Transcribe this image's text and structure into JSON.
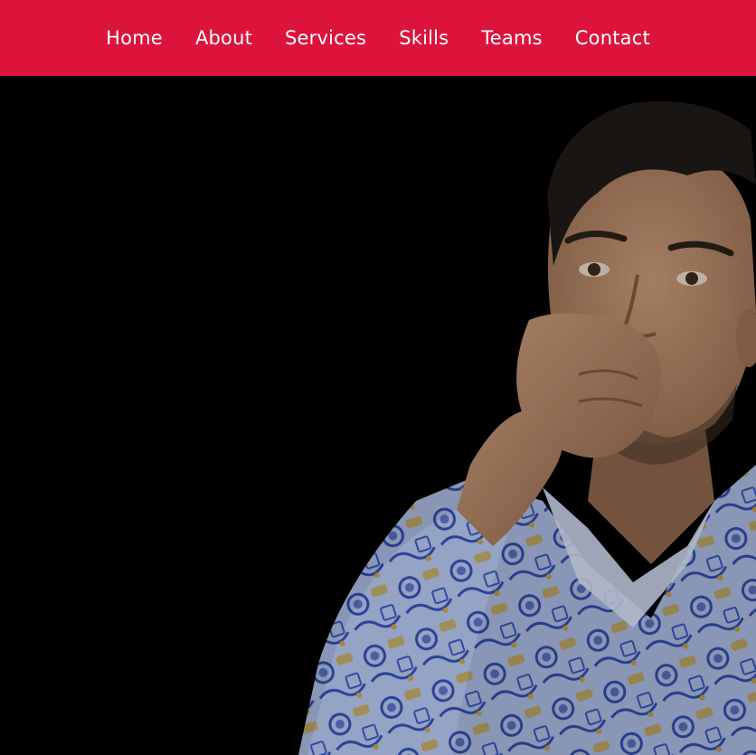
{
  "colors": {
    "nav_bg": "#dc143c",
    "nav_text": "#ffffff",
    "hero_bg": "#000000",
    "skin": "#b98d6e",
    "skin_shadow": "#8e664c",
    "hair": "#1e1a17",
    "shirt_base": "#b7c8f0",
    "shirt_pattern": "#3450b8",
    "shirt_accent": "#c9a84a"
  },
  "nav": {
    "items": [
      {
        "label": "Home"
      },
      {
        "label": "About"
      },
      {
        "label": "Services"
      },
      {
        "label": "Skills"
      },
      {
        "label": "Teams"
      },
      {
        "label": "Contact"
      }
    ]
  },
  "hero": {
    "image": "portrait-photo"
  }
}
